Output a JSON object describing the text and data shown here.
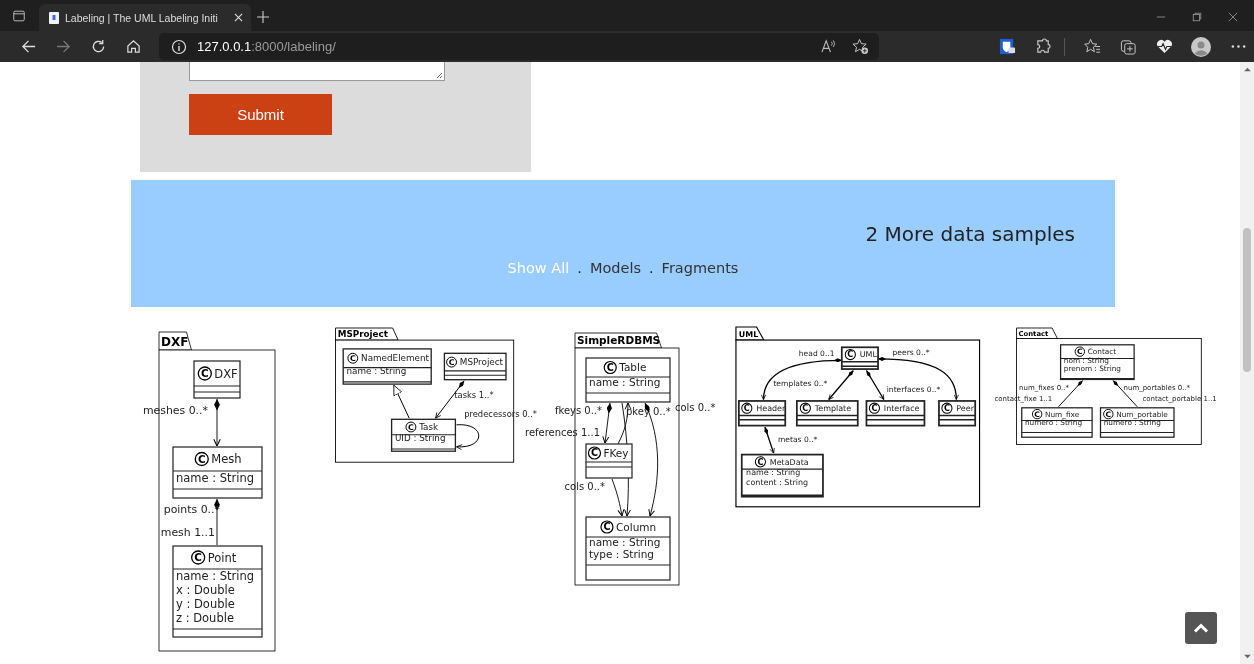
{
  "browser": {
    "tab_title": "Labeling | The UML Labeling Initi",
    "url_host": "127.0.0.1",
    "url_path": ":8000/labeling/"
  },
  "form": {
    "submit": "Submit"
  },
  "banner": {
    "heading": "2 More data samples",
    "items": [
      {
        "kind": "filter",
        "label": "Show All",
        "selected": true
      },
      {
        "kind": "separator",
        "label": "."
      },
      {
        "kind": "filter",
        "label": "Models",
        "selected": false
      },
      {
        "kind": "separator",
        "label": "."
      },
      {
        "kind": "filter",
        "label": "Fragments",
        "selected": false
      }
    ]
  },
  "diagrams": [
    {
      "package": "DXF",
      "classes": [
        {
          "icon": "C",
          "name": "DXF"
        },
        {
          "icon": "C",
          "name": "Mesh",
          "attributes": [
            "name : String"
          ]
        },
        {
          "icon": "C",
          "name": "Point",
          "attributes": [
            "name : String",
            "x : Double",
            "y : Double",
            "z : Double"
          ]
        }
      ],
      "relations": [
        {
          "kind": "composition",
          "labels": [
            "meshes 0..*"
          ]
        },
        {
          "kind": "composition_plain",
          "labels": [
            "points 0..*",
            "mesh 1..1"
          ]
        }
      ]
    },
    {
      "package": "MSProject",
      "classes": [
        {
          "icon": "C",
          "name": "NamedElement",
          "attributes": [
            "name : String"
          ]
        },
        {
          "icon": "C",
          "name": "MSProject"
        },
        {
          "icon": "C",
          "name": "Task",
          "attributes": [
            "UID : String"
          ]
        }
      ],
      "relations": [
        {
          "kind": "generalization"
        },
        {
          "kind": "composition",
          "labels": [
            "tasks 1..*"
          ]
        },
        {
          "kind": "association",
          "labels": [
            "predecessors 0..*"
          ]
        }
      ]
    },
    {
      "package": "SimpleRDBMS",
      "classes": [
        {
          "icon": "C",
          "name": "Table",
          "attributes": [
            "name : String"
          ]
        },
        {
          "icon": "C",
          "name": "FKey"
        },
        {
          "icon": "C",
          "name": "Column",
          "attributes": [
            "name : String",
            "type : String"
          ]
        }
      ],
      "relations": [
        {
          "kind": "composition",
          "labels": [
            "fkeys 0..*",
            "references 1..1"
          ]
        },
        {
          "kind": "association"
        },
        {
          "kind": "association",
          "labels": [
            "pkey 0..*"
          ]
        },
        {
          "kind": "composition",
          "labels": [
            "cols 0..*"
          ]
        },
        {
          "kind": "association",
          "labels": [
            "cols 0..*"
          ]
        }
      ]
    },
    {
      "package": "UML",
      "classes": [
        {
          "icon": "C",
          "name": "UML"
        },
        {
          "icon": "C",
          "name": "Header"
        },
        {
          "icon": "C",
          "name": "Template"
        },
        {
          "icon": "C",
          "name": "Interface"
        },
        {
          "icon": "C",
          "name": "Peer"
        },
        {
          "icon": "C",
          "name": "MetaData",
          "attributes": [
            "name : String",
            "content : String"
          ]
        }
      ],
      "relations": [
        {
          "kind": "composition",
          "labels": [
            "head 0..1"
          ]
        },
        {
          "kind": "composition",
          "labels": [
            "templates 0..*"
          ]
        },
        {
          "kind": "composition",
          "labels": [
            "interfaces 0..*"
          ]
        },
        {
          "kind": "composition",
          "labels": [
            "peers 0..*"
          ]
        },
        {
          "kind": "composition",
          "labels": [
            "metas 0..*"
          ]
        }
      ]
    },
    {
      "package": "Contact",
      "classes": [
        {
          "icon": "C",
          "name": "Contact",
          "attributes": [
            "nom : String",
            "prenom : String"
          ]
        },
        {
          "icon": "C",
          "name": "Num_fixe",
          "attributes": [
            "numero : String"
          ]
        },
        {
          "icon": "C",
          "name": "Num_portable",
          "attributes": [
            "numero : String"
          ]
        }
      ],
      "relations": [
        {
          "kind": "composition_plain",
          "labels": [
            "num_fixes 0..*",
            "contact_fixe 1..1"
          ]
        },
        {
          "kind": "composition_plain",
          "labels": [
            "num_portables 0..*",
            "contact_portable 1..1"
          ]
        }
      ]
    }
  ]
}
